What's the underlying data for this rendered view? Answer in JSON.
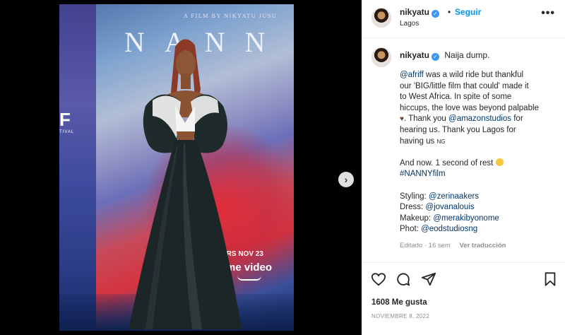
{
  "post_image": {
    "film_credit": "A FILM BY NIKYATU JUSU",
    "poster_title": "NANN",
    "festival_logo": "F",
    "festival_sub": "TIVAL",
    "release_text": "ERS NOV 23",
    "streaming_text": "me video",
    "next_icon": "chevron-right"
  },
  "header": {
    "username": "nikyatu",
    "separator": "•",
    "follow_label": "Seguir",
    "location": "Lagos",
    "more_label": "•••"
  },
  "caption": {
    "username": "nikyatu",
    "first_line": "Naija dump.",
    "para1": {
      "mention": "@afriff",
      "text_a": " was a wild ride but thankful",
      "line2": "our 'BIG/little film that could' made it",
      "line3": "to West Africa. In spite of some",
      "line4": "hiccups, the love was beyond palpable",
      "line5_a": ". Thank you ",
      "line5_mention": "@amazonstudios",
      "line5_b": " for",
      "line6": "hearing us. Thank you Lagos for",
      "line7_a": "having us ",
      "line7_flag": "NG"
    },
    "para2": {
      "line1": "And now. 1 second of rest ",
      "hashtag": "#NANNYfilm"
    },
    "credits": [
      {
        "label": "Styling: ",
        "handle": "@zerinaakers"
      },
      {
        "label": "Dress: ",
        "handle": "@jovanalouis"
      },
      {
        "label": "Makeup: ",
        "handle": "@merakibyonome"
      },
      {
        "label": "Phot: ",
        "handle": "@eodstudiosng"
      }
    ],
    "meta": "Editado · 16 sem",
    "translate_label": "Ver traducción"
  },
  "actions": {
    "likes": "1608 Me gusta",
    "date": "NOVIEMBRE 8, 2022"
  },
  "colors": {
    "link": "#00376b",
    "follow": "#0095f6",
    "verified": "#3897f0"
  }
}
